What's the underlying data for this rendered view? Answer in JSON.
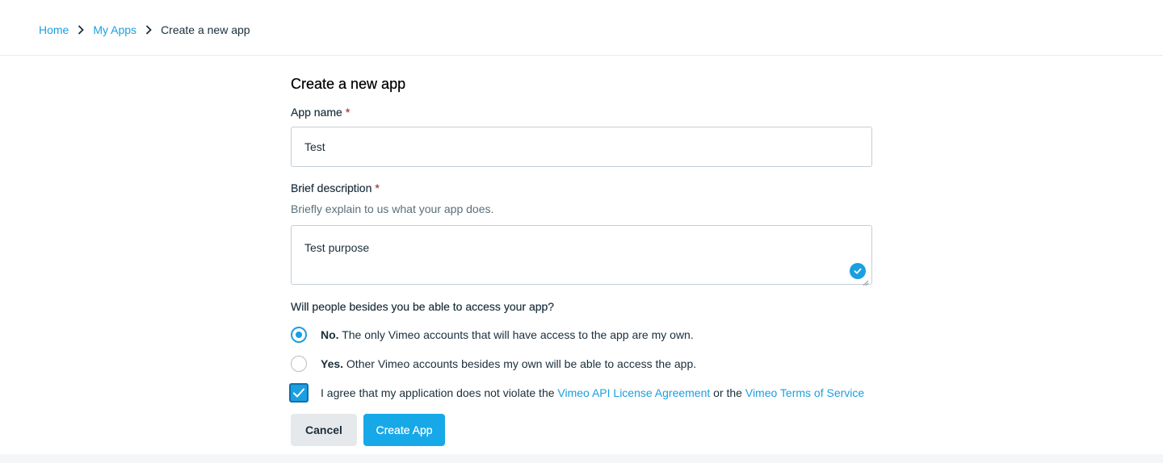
{
  "breadcrumb": {
    "home": "Home",
    "my_apps": "My Apps",
    "current": "Create a new app"
  },
  "form": {
    "title": "Create a new app",
    "app_name": {
      "label": "App name",
      "required_mark": "*",
      "value": "Test"
    },
    "description": {
      "label": "Brief description",
      "required_mark": "*",
      "hint": "Briefly explain to us what your app does.",
      "value": "Test purpose"
    },
    "access": {
      "question": "Will people besides you be able to access your app?",
      "options": [
        {
          "bold": "No.",
          "text": " The only Vimeo accounts that will have access to the app are my own.",
          "selected": true
        },
        {
          "bold": "Yes.",
          "text": " Other Vimeo accounts besides my own will be able to access the app.",
          "selected": false
        }
      ]
    },
    "agreement": {
      "checked": true,
      "prefix": "I agree that my application does not violate the ",
      "link1": "Vimeo API License Agreement",
      "middle": " or the ",
      "link2": "Vimeo Terms of Service"
    },
    "buttons": {
      "cancel": "Cancel",
      "create": "Create App"
    }
  },
  "colors": {
    "accent": "#1a9fe0",
    "required": "#e0262d",
    "text": "#1a2e3b"
  }
}
